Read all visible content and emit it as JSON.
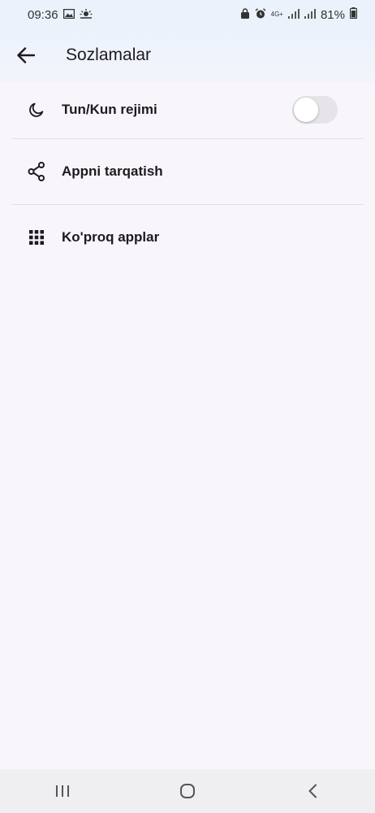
{
  "status_bar": {
    "time": "09:36",
    "battery": "81%",
    "network": "4G+"
  },
  "header": {
    "title": "Sozlamalar"
  },
  "settings": {
    "items": [
      {
        "label": "Tun/Kun rejimi",
        "icon": "moon-icon"
      },
      {
        "label": "Appni tarqatish",
        "icon": "share-icon"
      },
      {
        "label": "Ko'proq applar",
        "icon": "apps-grid-icon"
      }
    ],
    "dark_mode_enabled": false
  },
  "colors": {
    "status_bar_bg": "#ebf2fc",
    "background": "#f8f6fa",
    "divider": "#e2e0e5",
    "toggle_off": "#e6e4e8",
    "nav_bar_bg": "#efeef0"
  }
}
